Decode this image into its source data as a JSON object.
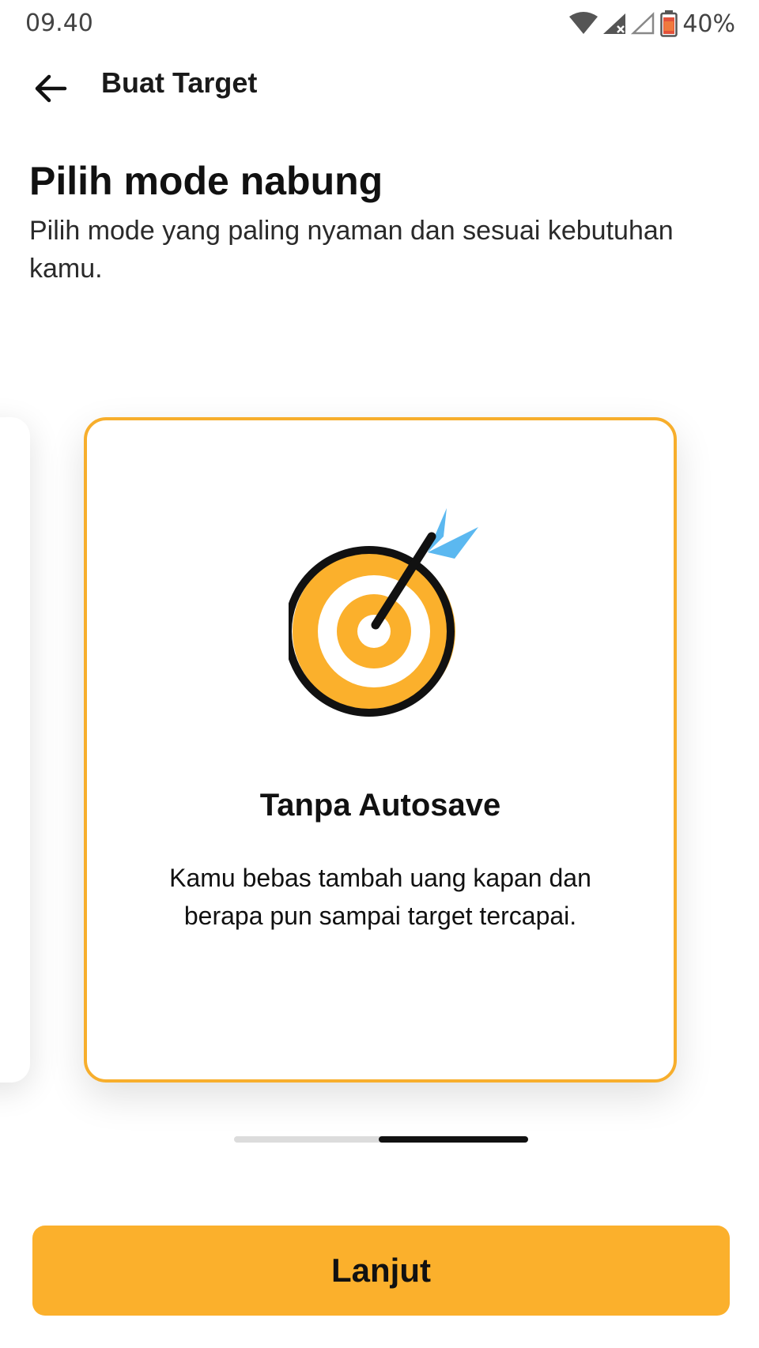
{
  "status_bar": {
    "time": "09.40",
    "battery_percent": "40%",
    "icons": [
      "wifi-icon",
      "signal-icon",
      "signal-empty-icon",
      "battery-icon"
    ]
  },
  "app_bar": {
    "back_icon": "arrow-left-icon",
    "title": "Buat Target"
  },
  "header": {
    "title": "Pilih mode nabung",
    "subtitle": "Pilih mode yang paling nyaman dan sesuai kebutuhan kamu."
  },
  "carousel": {
    "active_index": 1,
    "page_count": 2,
    "card": {
      "icon": "target-icon",
      "title": "Tanpa Autosave",
      "description": "Kamu bebas tambah uang kapan dan berapa pun sampai target tercapai."
    }
  },
  "footer": {
    "next_label": "Lanjut"
  },
  "colors": {
    "accent": "#fbb02c",
    "card_border": "#f7ae2c",
    "arrow_fletching": "#5bb8f0"
  }
}
